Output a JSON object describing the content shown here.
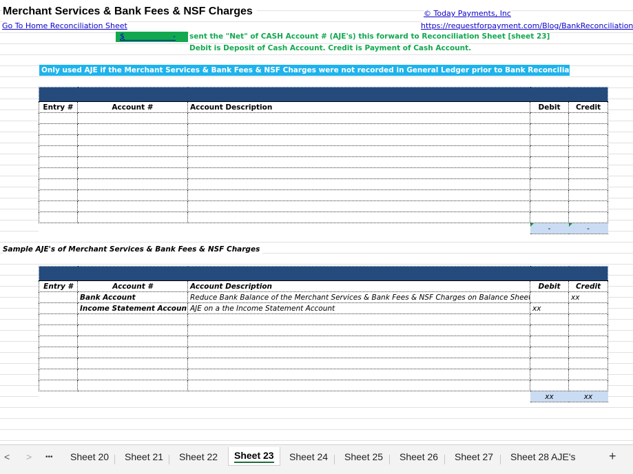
{
  "header": {
    "title": "Merchant Services & Bank Fees & NSF Charges",
    "home_link": "Go To Home Reconciliation Sheet",
    "company_link": "© Today Payments, Inc",
    "url_link": "https://requestforpayment.com/Blog/BankReconciliation"
  },
  "net_box": {
    "dollar": "$",
    "dash": "-",
    "note1": "sent the \"Net\" of CASH Account # (AJE's) this forward to Reconciliation Sheet [sheet 23]",
    "note2": "Debit is Deposit of Cash Account.  Credit is Payment of Cash Account."
  },
  "banner": "Only used AJE if the Merchant Services & Bank Fees & NSF Charges were not recorded in General Ledger prior to Bank Reconciliation sheet.",
  "table1": {
    "columns": [
      "Entry #",
      "Account #",
      "Account Description",
      "Debit",
      "Credit"
    ],
    "totals": [
      "-",
      "-"
    ]
  },
  "sample_label": "Sample AJE's of Merchant Services & Bank Fees & NSF Charges",
  "table2": {
    "columns": [
      "Entry #",
      "Account #",
      "Account Description",
      "Debit",
      "Credit"
    ],
    "rows": [
      {
        "entry": "",
        "account": "Bank Account",
        "description": "Reduce Bank Balance of the Merchant Services & Bank Fees & NSF Charges on Balance Sheet",
        "debit": "",
        "credit": "xx"
      },
      {
        "entry": "",
        "account": "Income Statement Account",
        "description": "AJE on a the Income Statement Account",
        "debit": "xx",
        "credit": ""
      }
    ],
    "totals": [
      "xx",
      "xx"
    ]
  },
  "tabs": {
    "prev": "<",
    "next": ">",
    "more": "•••",
    "items": [
      "Sheet 20",
      "Sheet 21",
      "Sheet 22",
      "Sheet 23",
      "Sheet 24",
      "Sheet 25",
      "Sheet 26",
      "Sheet 27",
      "Sheet 28 AJE's"
    ],
    "active": "Sheet 23",
    "add": "+"
  }
}
